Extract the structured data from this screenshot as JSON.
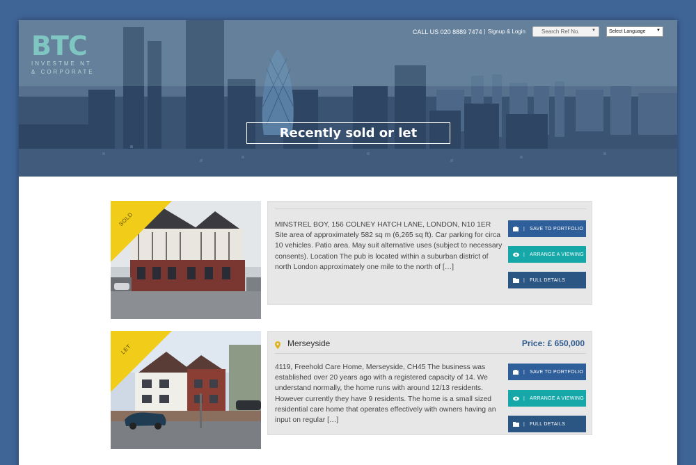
{
  "header": {
    "logo_mark": "BTC",
    "logo_line1": "INVESTME NT",
    "logo_line2": "& CORPORATE",
    "call": "CALL US 020 8889 7474",
    "separator": "|",
    "signup": "Signup & Login",
    "search_placeholder": "Search Ref No.",
    "language": "Select Language"
  },
  "hero": {
    "title": "Recently sold or let"
  },
  "listings": [
    {
      "badge": "SOLD",
      "location": "",
      "price": "",
      "description": "MINSTREL BOY, 156 COLNEY HATCH LANE, LONDON, N10 1ER Site area of approximately 582 sq m (6,265 sq ft). Car parking for circa 10 vehicles. Patio area. May suit alternative uses (subject to necessary consents).   Location The pub is located within a suburban district of north London approximately one mile to the north of […]",
      "btn_save": "SAVE TO PORTFOLIO",
      "btn_view": "ARRANGE A VIEWING",
      "btn_details": "FULL DETAILS"
    },
    {
      "badge": "LET",
      "location": "Merseyside",
      "price": "Price: £ 650,000",
      "description": "4119, Freehold Care Home, Merseyside, CH45 The business was established over 20 years ago with a registered capacity of 14. We understand normally, the home runs with around 12/13 residents. However currently they have 9 residents. The home is a small sized residential care home that operates effectively with owners having an input on regular […]",
      "btn_save": "SAVE TO PORTFOLIO",
      "btn_view": "ARRANGE A VIEWING",
      "btn_details": "FULL DETAILS"
    }
  ],
  "icons": {
    "save": "portfolio-icon",
    "view": "eye-icon",
    "details": "folder-icon",
    "location": "map-pin-icon"
  },
  "colors": {
    "page_bg": "#3f6496",
    "logo": "#7fc6c2",
    "ribbon": "#f1cd1a",
    "btn_blue": "#2f5f9b",
    "btn_teal": "#16a8a8",
    "btn_navy": "#2b5582",
    "price": "#2f5b8e"
  }
}
